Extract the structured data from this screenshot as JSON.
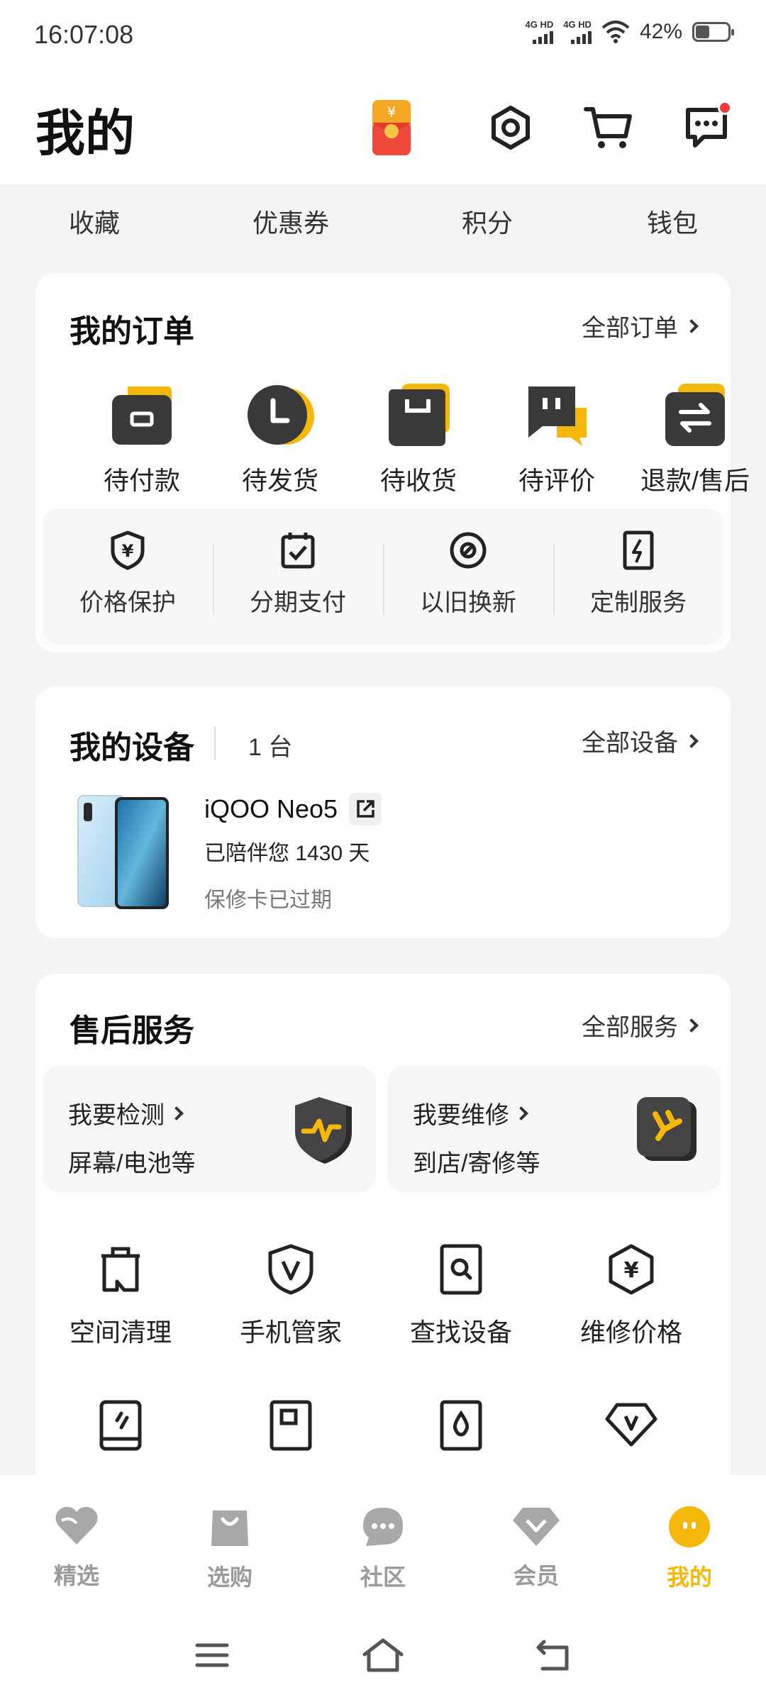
{
  "status_bar": {
    "time": "16:07:08",
    "network1": "4G HD",
    "network2": "4G HD",
    "battery": "42%"
  },
  "header": {
    "title": "我的"
  },
  "quick_links": [
    "收藏",
    "优惠券",
    "积分",
    "钱包"
  ],
  "orders": {
    "title": "我的订单",
    "all_label": "全部订单",
    "items": [
      "待付款",
      "待发货",
      "待收货",
      "待评价",
      "退款/售后"
    ],
    "services": [
      "价格保护",
      "分期支付",
      "以旧换新",
      "定制服务"
    ]
  },
  "devices": {
    "title": "我的设备",
    "count": "1 台",
    "all_label": "全部设备",
    "device": {
      "name": "iQOO Neo5",
      "days": "已陪伴您 1430 天",
      "warranty": "保修卡已过期"
    }
  },
  "after_sales": {
    "title": "售后服务",
    "all_label": "全部服务",
    "detect": {
      "title": "我要检测",
      "desc": "屏幕/电池等"
    },
    "repair": {
      "title": "我要维修",
      "desc": "到店/寄修等"
    },
    "tools": [
      "空间清理",
      "手机管家",
      "查找设备",
      "维修价格"
    ]
  },
  "bottom_nav": {
    "items": [
      "精选",
      "选购",
      "社区",
      "会员",
      "我的"
    ],
    "active": "我的"
  },
  "colors": {
    "accent": "#f5b80a",
    "dark_icon": "#3a3a3a",
    "notification": "#f53b3b"
  }
}
